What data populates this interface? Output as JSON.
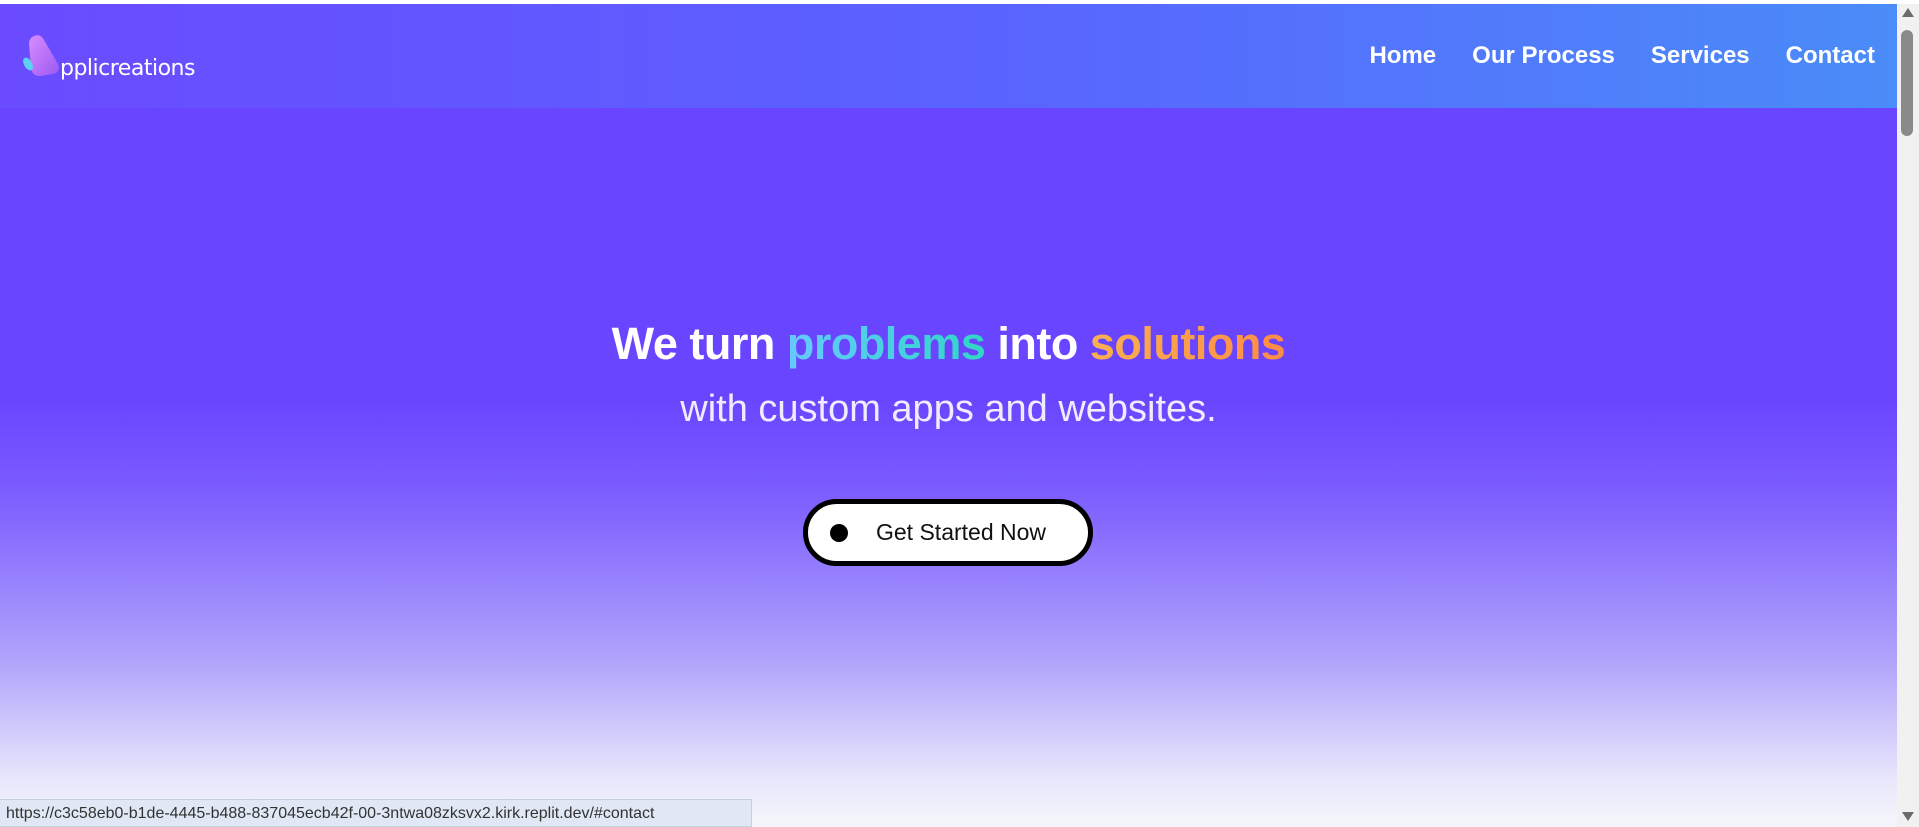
{
  "brand": {
    "logo_text": "pplicreations"
  },
  "nav": {
    "items": [
      "Home",
      "Our Process",
      "Services",
      "Contact"
    ]
  },
  "hero": {
    "headline_part1": "We turn ",
    "headline_word1": "problems",
    "headline_part2": " into ",
    "headline_word2": "solutions",
    "subheadline": "with custom apps and websites.",
    "cta_label": "Get Started Now"
  },
  "status_bar": {
    "url": "https://c3c58eb0-b1de-4445-b488-837045ecb42f-00-3ntwa08zksvx2.kirk.replit.dev/#contact"
  },
  "colors": {
    "primary": "#6a45ff",
    "nav_gradient_end": "#4a8cf8",
    "accent_problems": "#2fd8c4",
    "accent_solutions": "#ff8c45"
  }
}
